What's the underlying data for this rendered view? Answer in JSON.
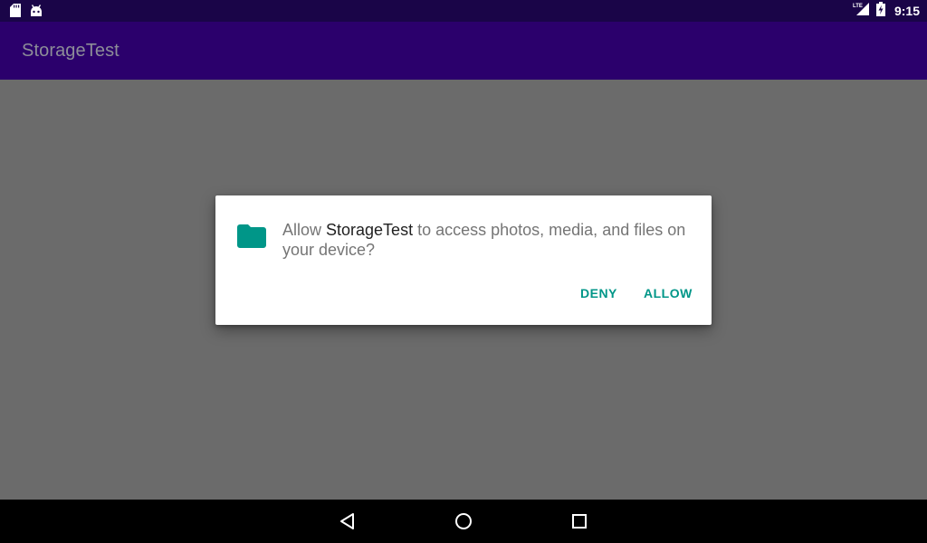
{
  "status_bar": {
    "left_icons": [
      "sd-card-icon",
      "android-icon"
    ],
    "network_label": "LTE",
    "time": "9:15"
  },
  "app_bar": {
    "title": "StorageTest"
  },
  "dialog": {
    "message_prefix": "Allow ",
    "app_name": "StorageTest",
    "message_suffix": " to access photos, media, and files on your device?",
    "icon": "folder-icon",
    "deny_label": "DENY",
    "allow_label": "ALLOW"
  },
  "nav_bar": {
    "buttons": [
      "back-icon",
      "home-icon",
      "recents-icon"
    ]
  },
  "colors": {
    "status_bar": "#1a0548",
    "app_bar": "#2b006c",
    "scrim": "#6b6b6b",
    "accent": "#009688"
  }
}
